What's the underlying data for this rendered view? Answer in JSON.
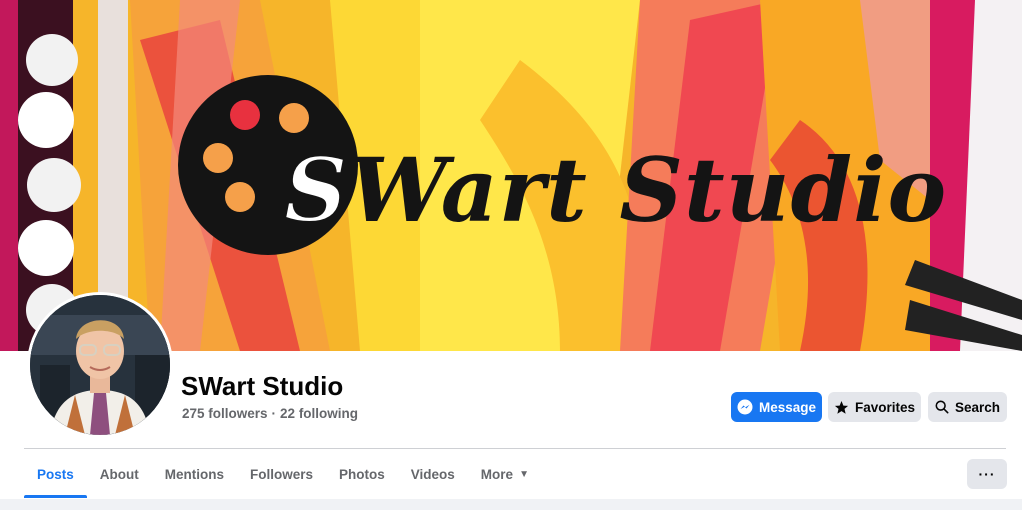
{
  "page": {
    "name": "SWart Studio",
    "followers": "275 followers",
    "separator": "·",
    "following": "22 following"
  },
  "cover": {
    "logo_text_first": "S",
    "logo_text_rest": "Wart Studio",
    "logo_icon": "film-reel-icon"
  },
  "actions": {
    "message_label": "Message",
    "message_icon": "messenger-icon",
    "favorites_label": "Favorites",
    "favorites_icon": "star-icon",
    "search_label": "Search",
    "search_icon": "search-icon",
    "overflow_label": "···"
  },
  "tabs": [
    {
      "label": "Posts",
      "active": true
    },
    {
      "label": "About",
      "active": false
    },
    {
      "label": "Mentions",
      "active": false
    },
    {
      "label": "Followers",
      "active": false
    },
    {
      "label": "Photos",
      "active": false
    },
    {
      "label": "Videos",
      "active": false
    },
    {
      "label": "More",
      "active": false,
      "caret": "▼"
    }
  ],
  "colors": {
    "accent": "#1877f2",
    "button_gray": "#e4e6eb",
    "text_primary": "#050505",
    "text_secondary": "#65676b"
  }
}
